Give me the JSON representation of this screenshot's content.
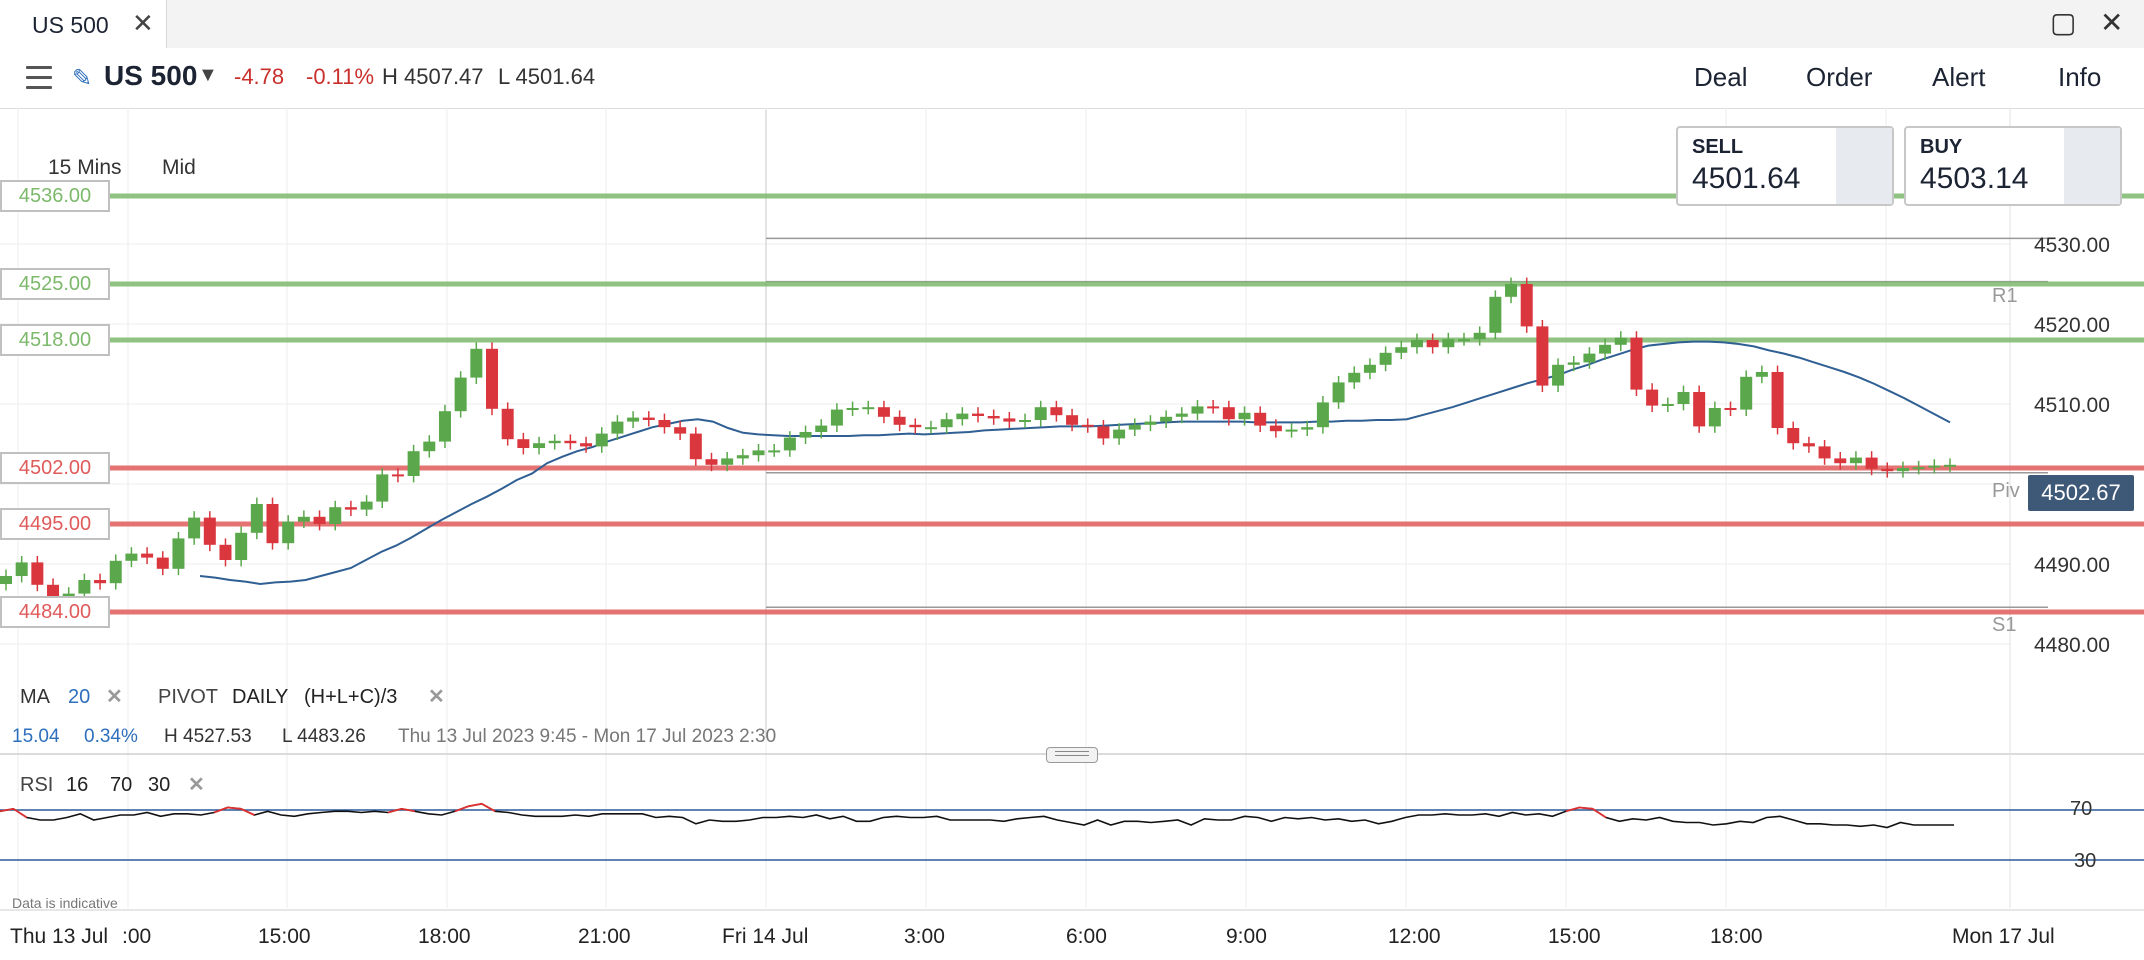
{
  "window": {
    "tab_title": "US 500"
  },
  "header": {
    "instrument": "US 500",
    "change": "-4.78",
    "change_pct": "-0.11%",
    "high": "H 4507.47",
    "low": "L 4501.64",
    "menu": [
      "Deal",
      "Order",
      "Alert",
      "Info"
    ]
  },
  "chart_settings": {
    "interval": "15 Mins",
    "price_type": "Mid"
  },
  "quotes": {
    "sell_label": "SELL",
    "sell": "4501.64",
    "buy_label": "BUY",
    "buy": "4503.14"
  },
  "levels": [
    {
      "label": "4536.00",
      "value": 4536,
      "color": "#7cb96b"
    },
    {
      "label": "4525.00",
      "value": 4525,
      "color": "#7cb96b"
    },
    {
      "label": "4518.00",
      "value": 4518,
      "color": "#7cb96b"
    },
    {
      "label": "4502.00",
      "value": 4502,
      "color": "#e05a5a"
    },
    {
      "label": "4495.00",
      "value": 4495,
      "color": "#e05a5a"
    },
    {
      "label": "4484.00",
      "value": 4484,
      "color": "#e05a5a"
    }
  ],
  "pivots": {
    "r1": "R1",
    "piv": "Piv",
    "s1": "S1"
  },
  "last_price": "4502.67",
  "indicators": {
    "ma_label": "MA",
    "ma_period": "20",
    "pivot_label": "PIVOT",
    "pivot_type": "DAILY",
    "pivot_formula": "(H+L+C)/3"
  },
  "stats": {
    "change": "15.04",
    "change_pct": "0.34%",
    "high": "H 4527.53",
    "low": "L 4483.26",
    "range": "Thu 13 Jul 2023 9:45 - Mon 17 Jul 2023 2:30"
  },
  "rsi": {
    "label": "RSI",
    "period": "16",
    "upper": "70",
    "lower": "30"
  },
  "footer_note": "Data is indicative",
  "chart_data": [
    {
      "type": "candlestick",
      "y_ticks": [
        "4530.00",
        "4520.00",
        "4510.00",
        "4500.00",
        "4490.00",
        "4480.00"
      ],
      "ylim": [
        4477,
        4547
      ],
      "x_ticks": [
        "Thu 13 Jul",
        ":00",
        "15:00",
        "18:00",
        "21:00",
        "Fri 14 Jul",
        "3:00",
        "6:00",
        "9:00",
        "12:00",
        "15:00",
        "18:00",
        "Mon 17 Jul"
      ],
      "close": [
        4488.5,
        4490.2,
        4487.4,
        4485.6,
        4486.3,
        4488.0,
        4487.6,
        4490.4,
        4491.3,
        4490.8,
        4489.4,
        4493.2,
        4495.8,
        4492.4,
        4490.5,
        4493.9,
        4497.5,
        4492.6,
        4495.3,
        4495.9,
        4495.0,
        4497.1,
        4496.8,
        4497.8,
        4501.2,
        4501.0,
        4504.1,
        4505.3,
        4509.1,
        4513.3,
        4516.9,
        4509.4,
        4505.6,
        4504.5,
        4505.1,
        4505.4,
        4505.1,
        4504.7,
        4506.3,
        4507.8,
        4508.3,
        4508.0,
        4507.1,
        4506.3,
        4503.1,
        4502.4,
        4503.2,
        4503.6,
        4504.2,
        4504.2,
        4505.8,
        4506.5,
        4507.3,
        4509.3,
        4509.5,
        4509.6,
        4508.4,
        4507.4,
        4507.1,
        4507.1,
        4508.1,
        4508.8,
        4508.5,
        4508.2,
        4507.8,
        4508.0,
        4509.6,
        4508.6,
        4507.4,
        4507.2,
        4505.7,
        4506.8,
        4507.4,
        4507.8,
        4508.4,
        4508.8,
        4509.7,
        4509.6,
        4508.1,
        4508.9,
        4507.3,
        4506.6,
        4506.8,
        4507.1,
        4510.2,
        4512.7,
        4513.9,
        4514.9,
        4516.4,
        4517.1,
        4518.0,
        4517.1,
        4518.1,
        4518.1,
        4518.9,
        4523.4,
        4525.0,
        4519.7,
        4512.3,
        4514.9,
        4515.2,
        4516.3,
        4517.4,
        4518.3,
        4511.8,
        4509.8,
        4510.0,
        4511.5,
        4507.2,
        4509.5,
        4509.3,
        4513.4,
        4514.0,
        4507.0,
        4505.1,
        4504.7,
        4503.2,
        4502.6,
        4503.3,
        4501.9,
        4501.6,
        4502.0,
        4502.1,
        4502.3,
        4502.4
      ],
      "ma20": [
        4488.5,
        4488.3,
        4488.0,
        4487.8,
        4487.5,
        4487.7,
        4487.8,
        4488.0,
        4488.5,
        4489.0,
        4489.5,
        4490.5,
        4491.5,
        4492.3,
        4493.3,
        4494.4,
        4495.5,
        4496.5,
        4497.5,
        4498.4,
        4499.4,
        4500.5,
        4501.3,
        4502.6,
        4503.4,
        4504.1,
        4504.6,
        4505.3,
        4505.9,
        4506.5,
        4507.1,
        4507.5,
        4507.9,
        4508.1,
        4507.8,
        4507.0,
        4506.4,
        4506.2,
        4506.1,
        4506.0,
        4506.0,
        4506.0,
        4506.0,
        4506.0,
        4506.1,
        4506.1,
        4506.2,
        4506.3,
        4506.2,
        4506.3,
        4506.4,
        4506.5,
        4506.7,
        4506.8,
        4506.9,
        4507.0,
        4507.1,
        4507.2,
        4507.2,
        4507.2,
        4507.3,
        4507.4,
        4507.5,
        4507.6,
        4507.7,
        4507.8,
        4507.8,
        4507.8,
        4507.8,
        4507.8,
        4507.7,
        4507.7,
        4507.7,
        4507.7,
        4507.8,
        4507.8,
        4507.9,
        4507.9,
        4508.0,
        4508.0,
        4508.1,
        4508.6,
        4509.1,
        4509.6,
        4510.2,
        4510.8,
        4511.4,
        4512.0,
        4512.6,
        4513.1,
        4513.6,
        4514.3,
        4514.9,
        4515.6,
        4516.2,
        4516.8,
        4517.3,
        4517.5,
        4517.7,
        4517.8,
        4517.8,
        4517.7,
        4517.5,
        4517.2,
        4516.7,
        4516.3,
        4515.8,
        4515.2,
        4514.6,
        4514.0,
        4513.3,
        4512.5,
        4511.6,
        4510.7,
        4509.7,
        4508.7,
        4507.7
      ]
    },
    {
      "type": "line",
      "name": "RSI",
      "ylim": [
        0,
        100
      ],
      "levels": [
        70,
        30
      ],
      "values": [
        69,
        71,
        64,
        62,
        62,
        64,
        67,
        62,
        64,
        66,
        66,
        68,
        65,
        67,
        67,
        66,
        68,
        72,
        71,
        66,
        69,
        66,
        65,
        67,
        68,
        69,
        69,
        68,
        69,
        68,
        71,
        69,
        67,
        66,
        69,
        73,
        75,
        69,
        68,
        66,
        65,
        65,
        65,
        66,
        65,
        67,
        67,
        67,
        67,
        64,
        65,
        64,
        59,
        62,
        61,
        61,
        62,
        64,
        64,
        65,
        64,
        66,
        63,
        65,
        61,
        61,
        64,
        65,
        64,
        64,
        65,
        62,
        62,
        62,
        62,
        61,
        63,
        64,
        65,
        62,
        60,
        58,
        62,
        58,
        61,
        61,
        60,
        61,
        62,
        58,
        63,
        62,
        62,
        65,
        64,
        61,
        64,
        63,
        64,
        62,
        63,
        61,
        62,
        59,
        61,
        64,
        66,
        66,
        67,
        66,
        66,
        67,
        65,
        68,
        66,
        67,
        65,
        69,
        72,
        71,
        64,
        61,
        63,
        62,
        64,
        61,
        60,
        60,
        58,
        59,
        61,
        60,
        64,
        65,
        62,
        59,
        59,
        58,
        58,
        57,
        58,
        56,
        60,
        58,
        58,
        58,
        58
      ]
    }
  ]
}
